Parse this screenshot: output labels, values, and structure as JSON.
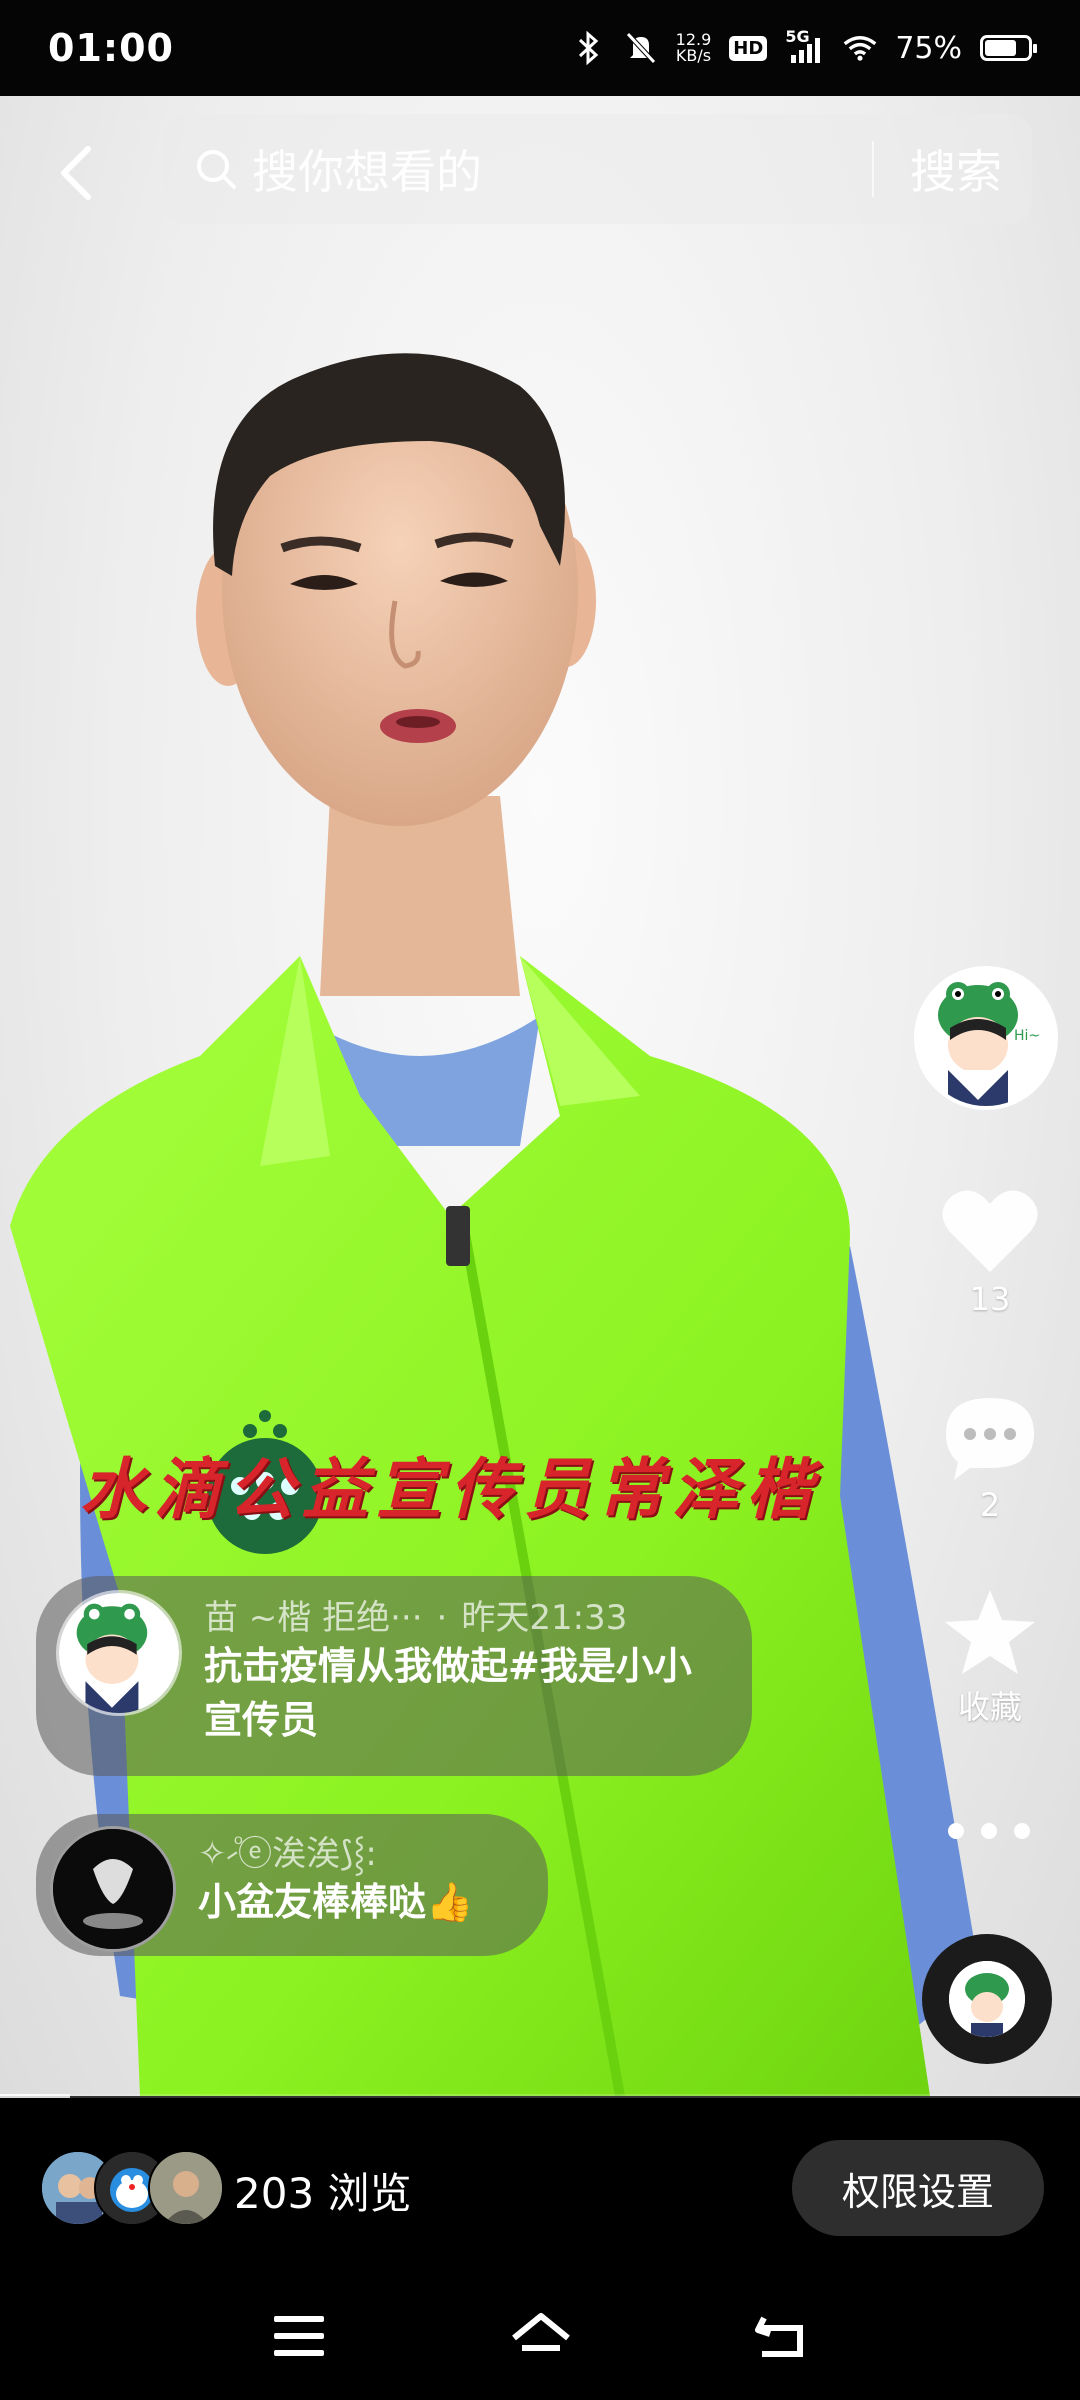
{
  "status_bar": {
    "time": "01:00",
    "net_speed": "12.9",
    "net_unit": "KB/s",
    "hd": "HD",
    "signal": "5G",
    "battery": "75%",
    "battery_level": 0.75
  },
  "search": {
    "placeholder": "搜你想看的",
    "button": "搜索"
  },
  "video": {
    "overlay_text": "水滴公益宣传员常泽楷",
    "progress": 0.065
  },
  "actions": {
    "likes": "13",
    "comments": "2",
    "favorite_label": "收藏"
  },
  "comments": [
    {
      "author": "苗 ~楷  拒绝···",
      "time": "昨天21:33",
      "text": "抗击疫情从我做起#我是小小宣传员"
    },
    {
      "author": "✧⹝ͦⓔ涘涘⟆⸾:",
      "text": "小盆友棒棒哒👍"
    }
  ],
  "bottom_bar": {
    "views": "203 浏览",
    "permission_button": "权限设置"
  },
  "colors": {
    "accent_red": "#d8242b",
    "vest_green": "#8cf221",
    "bar_background": "#000000"
  }
}
